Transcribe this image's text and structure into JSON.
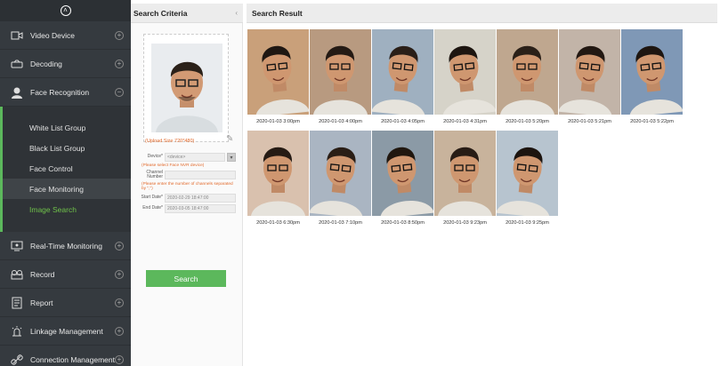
{
  "sidebar": {
    "collapse_icon": "chevron-up-icon",
    "items": [
      {
        "label": "Video Device",
        "icon": "camera-icon",
        "toggle": "+"
      },
      {
        "label": "Decoding",
        "icon": "decoder-icon",
        "toggle": "+"
      },
      {
        "label": "Face Recognition",
        "icon": "face-icon",
        "toggle": "−"
      },
      {
        "label": "Real-Time Monitoring",
        "icon": "monitor-icon",
        "toggle": "+"
      },
      {
        "label": "Record",
        "icon": "record-icon",
        "toggle": "+"
      },
      {
        "label": "Report",
        "icon": "report-icon",
        "toggle": "+"
      },
      {
        "label": "Linkage Management",
        "icon": "alarm-icon",
        "toggle": "+"
      },
      {
        "label": "Connection Management",
        "icon": "link-icon",
        "toggle": "+"
      }
    ],
    "face_submenu": [
      {
        "label": "White List Group"
      },
      {
        "label": "Black List Group"
      },
      {
        "label": "Face Control"
      },
      {
        "label": "Face Monitoring"
      },
      {
        "label": "Image Search"
      }
    ]
  },
  "search_criteria": {
    "title": "Search Criteria",
    "query_label": "(Upload Size 720*480)",
    "device_label": "Device*",
    "device_value": "<device>",
    "device_hint": "(Please select Face NVR device)",
    "channel_label": "Channel Number",
    "channel_hint": "(Please enter the number of channels separated by \",\")",
    "start_label": "Start Date*",
    "start_value": "2020-02-29 18:47:00",
    "end_label": "End Date*",
    "end_value": "2020-03-05 18:47:00",
    "search_button": "Search"
  },
  "search_result": {
    "title": "Search Result",
    "items": [
      {
        "timestamp": "2020-01-03 3:00pm"
      },
      {
        "timestamp": "2020-01-03 4:00pm"
      },
      {
        "timestamp": "2020-01-03 4:05pm"
      },
      {
        "timestamp": "2020-01-03 4:31pm"
      },
      {
        "timestamp": "2020-01-03 5:20pm"
      },
      {
        "timestamp": "2020-01-03 5:21pm"
      },
      {
        "timestamp": "2020-01-03 5:22pm"
      },
      {
        "timestamp": "2020-01-03 6:30pm"
      },
      {
        "timestamp": "2020-01-03 7:10pm"
      },
      {
        "timestamp": "2020-01-03 8:50pm"
      },
      {
        "timestamp": "2020-01-03 9:23pm"
      },
      {
        "timestamp": "2020-01-03 9:25pm"
      }
    ]
  },
  "colors": {
    "sidebar_bg": "#353a3f",
    "accent_green": "#5cb85c",
    "hint_orange": "#e26a2c",
    "header_bg": "#ececec"
  }
}
